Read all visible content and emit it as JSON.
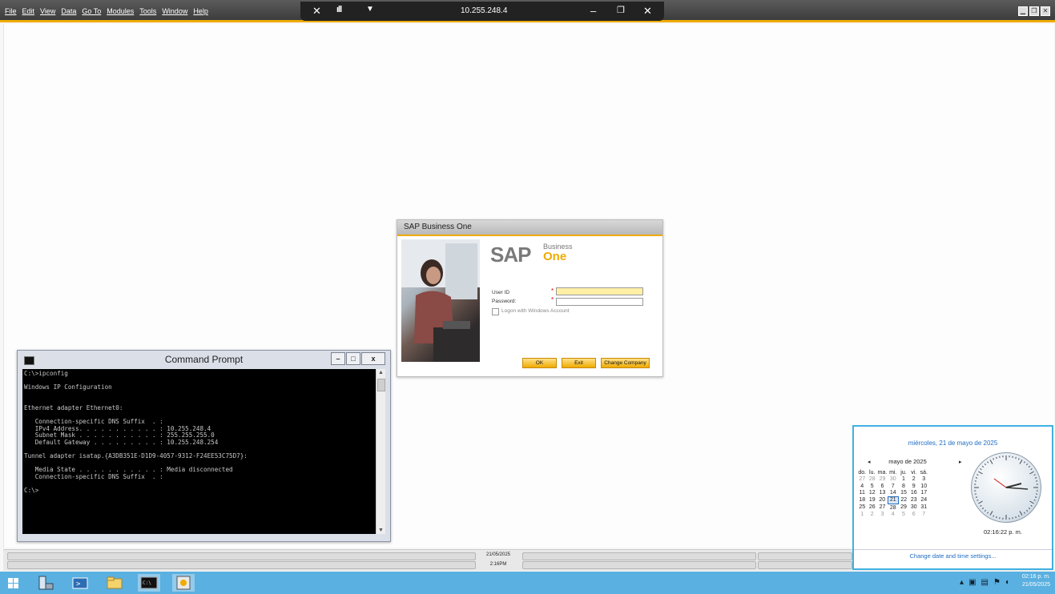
{
  "menubar": {
    "items": [
      "File",
      "Edit",
      "View",
      "Data",
      "Go To",
      "Modules",
      "Tools",
      "Window",
      "Help"
    ]
  },
  "rdp": {
    "ip": "10.255.248.4"
  },
  "sap": {
    "window_title": "SAP Business One",
    "logo_sap": "SAP",
    "logo_business": "Business",
    "logo_one": "One",
    "user_label": "User ID",
    "password_label": "Password:",
    "windows_logon": "Logon with Windows Account",
    "ok": "OK",
    "exit": "Exit",
    "change_company": "Change Company",
    "user_value": "",
    "password_value": ""
  },
  "cmd": {
    "title": "Command Prompt",
    "lines": [
      "C:\\>ipconfig",
      "",
      "Windows IP Configuration",
      "",
      "",
      "Ethernet adapter Ethernet0:",
      "",
      "   Connection-specific DNS Suffix  . :",
      "   IPv4 Address. . . . . . . . . . . : 10.255.248.4",
      "   Subnet Mask . . . . . . . . . . . : 255.255.255.0",
      "   Default Gateway . . . . . . . . . : 10.255.248.254",
      "",
      "Tunnel adapter isatap.{A3DB351E-D1D9-4057-9312-F24EE53C75D7}:",
      "",
      "   Media State . . . . . . . . . . . : Media disconnected",
      "   Connection-specific DNS Suffix  . :",
      "",
      "C:\\>"
    ]
  },
  "statusbar": {
    "date": "21/05/2025",
    "time": "2:16PM"
  },
  "calendar": {
    "header": "miércoles, 21 de mayo de 2025",
    "month": "mayo de 2025",
    "weekdays": [
      "do.",
      "lu.",
      "ma.",
      "mi.",
      "ju.",
      "vi.",
      "sá."
    ],
    "weeks": [
      [
        "27",
        "28",
        "29",
        "30",
        "1",
        "2",
        "3"
      ],
      [
        "4",
        "5",
        "6",
        "7",
        "8",
        "9",
        "10"
      ],
      [
        "11",
        "12",
        "13",
        "14",
        "15",
        "16",
        "17"
      ],
      [
        "18",
        "19",
        "20",
        "21",
        "22",
        "23",
        "24"
      ],
      [
        "25",
        "26",
        "27",
        "28",
        "29",
        "30",
        "31"
      ],
      [
        "1",
        "2",
        "3",
        "4",
        "5",
        "6",
        "7"
      ]
    ],
    "clock_time": "02:16:22 p. m.",
    "settings_link": "Change date and time settings..."
  },
  "taskbar": {
    "time": "02:16 p. m.",
    "date": "21/05/2025"
  },
  "colors": {
    "accent": "#f0ab00",
    "taskbar": "#5ab0e0",
    "link": "#1e6dc2"
  }
}
